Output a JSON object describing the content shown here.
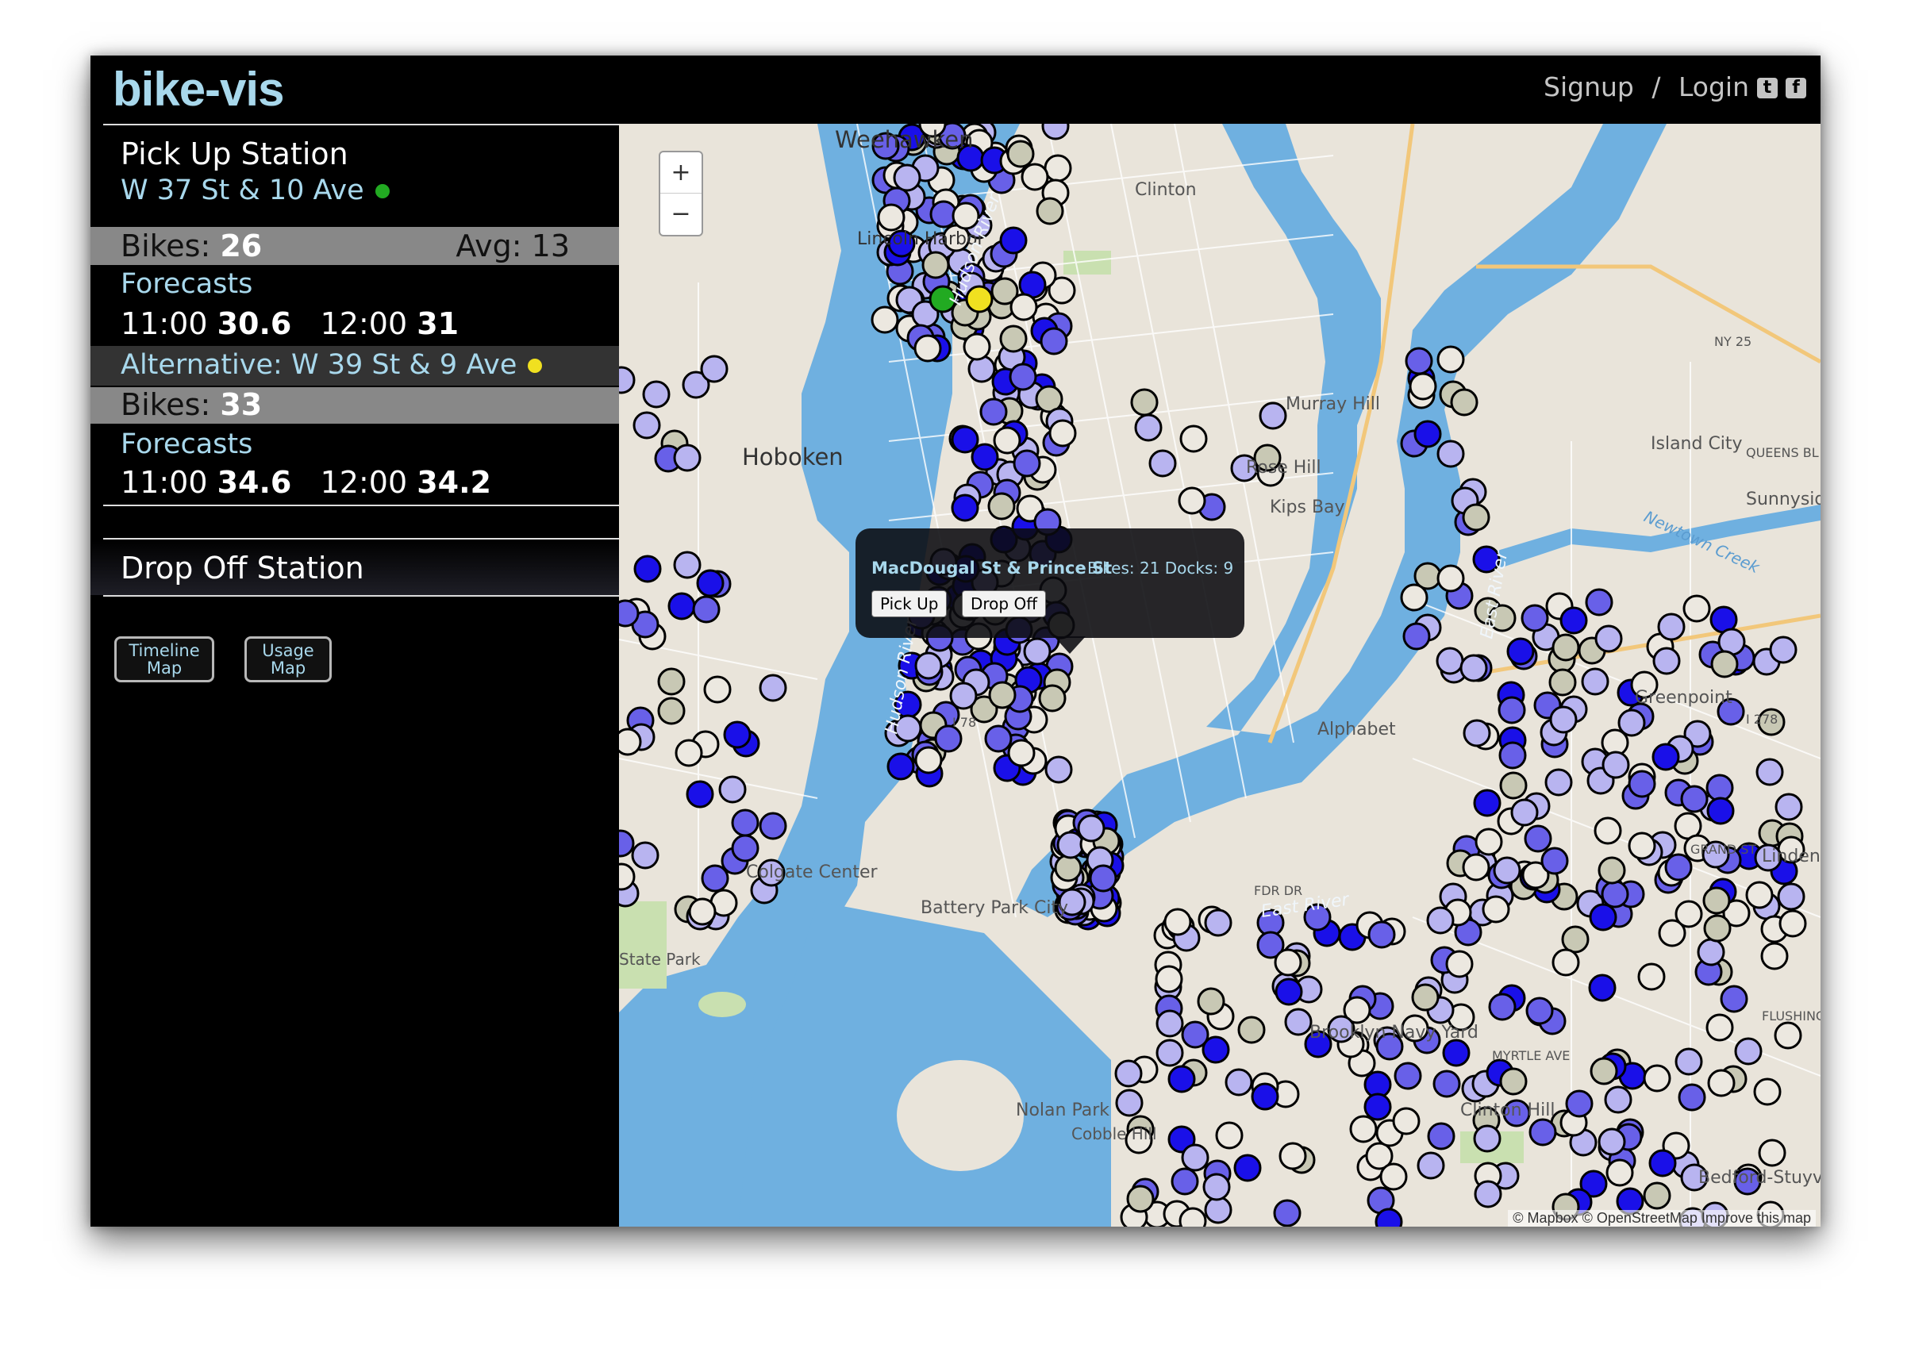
{
  "header": {
    "brand": "bike-vis",
    "signup": "Signup",
    "separator": "/",
    "login": "Login"
  },
  "sidebar": {
    "pickup": {
      "title": "Pick Up Station",
      "station": "W 37 St & 10 Ave",
      "station_dot_color": "#22aa22",
      "bikes_label": "Bikes:",
      "bikes_value": "26",
      "avg_label": "Avg:",
      "avg_value": "13",
      "forecasts_title": "Forecasts",
      "f1_time": "11:00",
      "f1_value": "30.6",
      "f2_time": "12:00",
      "f2_value": "31"
    },
    "alternative": {
      "label": "Alternative:",
      "station": "W 39 St & 9 Ave",
      "dot_color": "#f0e020",
      "bikes_label": "Bikes:",
      "bikes_value": "33",
      "forecasts_title": "Forecasts",
      "f1_time": "11:00",
      "f1_value": "34.6",
      "f2_time": "12:00",
      "f2_value": "34.2"
    },
    "dropoff": {
      "title": "Drop Off Station"
    },
    "buttons": {
      "timeline_line1": "Timeline",
      "timeline_line2": "Map",
      "usage_line1": "Usage",
      "usage_line2": "Map"
    }
  },
  "map": {
    "zoom_in": "+",
    "zoom_out": "−",
    "labels": {
      "weehawken": "Weehawken",
      "hoboken": "Hoboken",
      "lincoln_harbor": "Lincoln Harbor",
      "clinton": "Clinton",
      "hudson_river": "Hudson River",
      "east_river": "East River",
      "murray_hill": "Murray Hill",
      "rose_hill": "Rose Hill",
      "kips_bay": "Kips Bay",
      "sunnyside": "Sunnyside",
      "newtown_creek": "Newtown Creek",
      "island_city": "Island City",
      "greenpoint": "Greenpoint",
      "alphabet": "Alphabet",
      "battery_park_city": "Battery Park City",
      "colgate_center": "Colgate Center",
      "nolan_park": "Nolan Park",
      "brooklyn_navy_yard": "Brooklyn Navy Yard",
      "clinton_hill": "Clinton Hill",
      "bedford_stuyvesant": "Bedford-Stuyvesant",
      "linden": "Linden",
      "state_park": "State Park",
      "cobble_hill": "Cobble Hill",
      "fdr_dr": "FDR DR",
      "ny25": "NY 25",
      "i278": "I 278",
      "i78": "I 78",
      "queens_bl": "QUEENS BL",
      "flushing_ave": "FLUSHING AVE",
      "myrtle_ave": "MYRTLE AVE",
      "grand_st": "GRAND ST"
    },
    "attribution": "© Mapbox © OpenStreetMap Improve this map"
  },
  "popup": {
    "station": "MacDougal St & Prince St",
    "info": "Bikes: 21 Docks: 9",
    "pickup_button": "Pick Up",
    "dropoff_button": "Drop Off"
  },
  "colors": {
    "brand": "#a8d8ec",
    "water": "#6fb0e0",
    "land": "#e9e4da",
    "band_bikes": "#888888",
    "band_alt": "#333333",
    "station_dark": "#1a10e8",
    "station_mid": "#6860e8",
    "station_light": "#b8b4f0",
    "station_empty": "#ece8e0",
    "station_gray": "#c8c8b4"
  }
}
